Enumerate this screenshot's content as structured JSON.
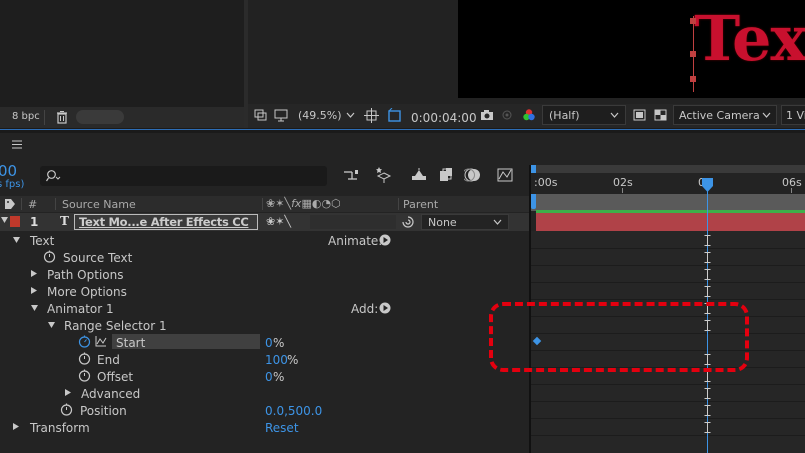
{
  "project": {
    "bpc": "8 bpc"
  },
  "comp_viewer": {
    "preview_text": "Text",
    "zoom": "(49.5%)",
    "timecode": "0:00:04:00",
    "resolution": "(Half)",
    "camera": "Active Camera",
    "view": "1 Vi"
  },
  "timeline": {
    "current_time_partial": "00",
    "fps_partial": "s fps)",
    "search_placeholder": "",
    "ruler_labels": [
      ":00s",
      "02s",
      "0",
      "06s"
    ],
    "headers": {
      "hash": "#",
      "source_name": "Source Name",
      "switches": "❀ ✶ \\ fx",
      "parent": "Parent"
    },
    "layer": {
      "number": "1",
      "type_glyph": "T",
      "name": "Text Mo...e After Effects CC",
      "parent_value": "None"
    },
    "properties": {
      "text": "Text",
      "animate_label": "Animate:",
      "source_text": "Source Text",
      "path_options": "Path Options",
      "more_options": "More Options",
      "animator": "Animator 1",
      "add_label": "Add:",
      "range_selector": "Range Selector 1",
      "start": "Start",
      "start_value": "0",
      "start_unit": "%",
      "end": "End",
      "end_value": "100",
      "end_unit": "%",
      "offset": "Offset",
      "offset_value": "0",
      "offset_unit": "%",
      "advanced": "Advanced",
      "position": "Position",
      "position_value": "0.0,500.0",
      "transform": "Transform",
      "reset": "Reset"
    }
  },
  "colors": {
    "accent_blue": "#3d94e6",
    "highlight_red": "#e4000f",
    "layer_bar_red": "#b04248",
    "layer_label_red": "#c0392b"
  }
}
